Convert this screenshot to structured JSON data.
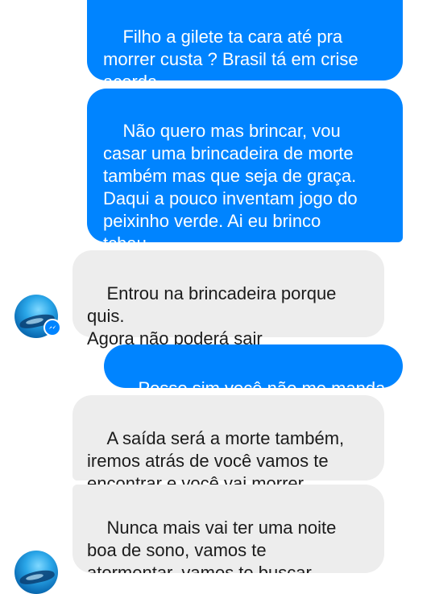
{
  "conversation": {
    "messages": [
      {
        "direction": "sent",
        "text": "Filho a gilete ta cara até pra\nmorrer custa ? Brasil tá em crise\nacorda."
      },
      {
        "direction": "sent",
        "text": "Não quero mas brincar, vou\ncasar uma brincadeira de morte\ntambém mas que seja de graça.\nDaqui a pouco inventam jogo do\npeixinho verde. Ai eu brinco\ntchau"
      },
      {
        "direction": "received",
        "text": "Entrou na brincadeira porque\nquis.\nAgora não poderá sair"
      },
      {
        "direction": "sent",
        "text": "Posso sim você não me manda"
      },
      {
        "direction": "received",
        "text": "A saída será a morte também,\niremos atrás de você vamos te\nencontrar e você vai morrer"
      },
      {
        "direction": "received",
        "text": "Nunca mais vai ter uma noite\nboa de sono, vamos te\natormentar, vamos te buscar"
      }
    ],
    "contact_avatar": {
      "icon": "whale-photo-avatar",
      "badge_icon": "messenger-icon"
    }
  },
  "colors": {
    "sent_bubble": "#0084ff",
    "received_bubble": "#ededed",
    "background": "#ffffff"
  }
}
